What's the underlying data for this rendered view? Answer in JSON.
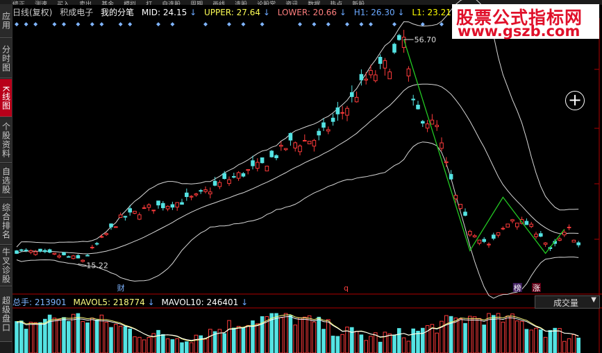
{
  "sidebar": {
    "tabs": [
      {
        "label": "应用",
        "active": false
      },
      {
        "label": "分时图",
        "active": false
      },
      {
        "label": "K线图",
        "active": true
      },
      {
        "label": "个股资料",
        "active": false
      },
      {
        "label": "自选股",
        "active": false
      },
      {
        "label": "综合排名",
        "active": false
      },
      {
        "label": "牛叉诊股",
        "active": false
      },
      {
        "label": "超级盘口",
        "active": false
      }
    ]
  },
  "toolbar": {
    "items": [
      "修正",
      "测速",
      "买入",
      "卖出",
      "基金",
      "模拟",
      "打",
      "自选股",
      "周期",
      "画线",
      "选股",
      "论股堂",
      "资讯",
      "数据",
      "热点",
      "新股"
    ]
  },
  "infobar": {
    "period": "日线(复权)",
    "stock": "积成电子",
    "indicator": "我的分笔",
    "mid": "MID: 24.15",
    "upper": "UPPER: 27.64",
    "lower": "LOWER: 20.66",
    "h1": "H1: 26.30",
    "l1": "L1: 23.21",
    "arrow": "↓"
  },
  "chart": {
    "high_label": "56.70",
    "low_label": "15.22",
    "markers": {
      "cai": "财",
      "q": "q",
      "bang": "榜",
      "zhang": "涨"
    }
  },
  "volume": {
    "total": "总手: 213901",
    "mavol5": "MAVOL5: 218774",
    "mavol10": "MAVOL10: 246401",
    "arrow": "↓",
    "selector": "成交量"
  },
  "watermark": {
    "title": "股票公式指标网",
    "url": "www.gszb.com"
  },
  "zoom": {
    "icon": "plus-circle-icon",
    "glyph": "+"
  },
  "colors": {
    "up": "#ff3b3b",
    "down": "#54e3e3",
    "boll": "#d8d8d8",
    "zigzag": "#23c923",
    "mid": "#ffffff",
    "upper": "#ffff55",
    "lower": "#ff7f7f",
    "h1": "#6aa8ff",
    "l1": "#ffff00",
    "mavol5": "#ffff80",
    "mavol10": "#ffffff",
    "signal": "#7fb4ff"
  }
}
